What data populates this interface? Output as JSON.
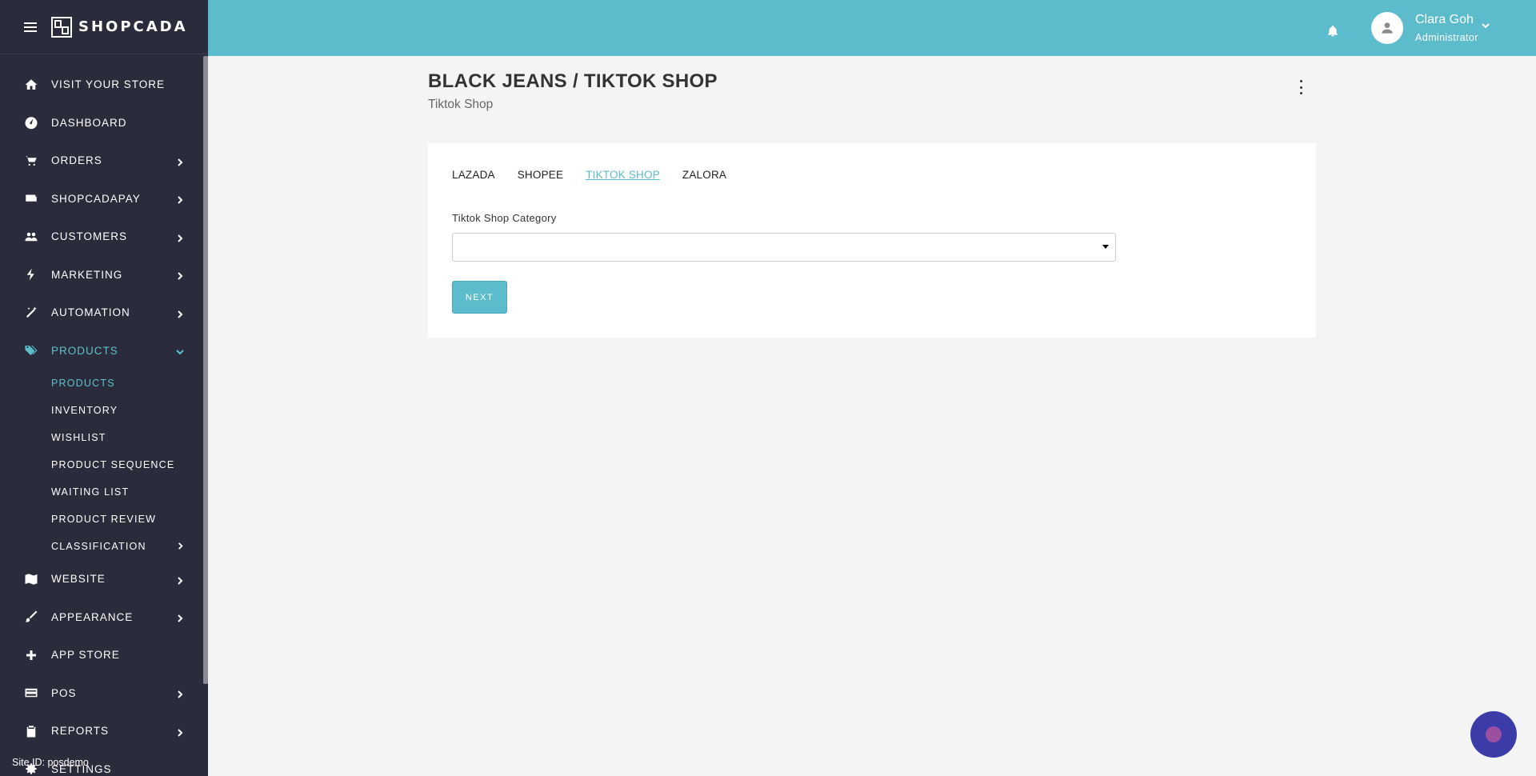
{
  "brand": {
    "name": "SHOPCADA"
  },
  "sidebar": {
    "items": [
      {
        "label": "VISIT YOUR STORE",
        "icon": "home-icon",
        "has_children": false
      },
      {
        "label": "DASHBOARD",
        "icon": "dashboard-icon",
        "has_children": false
      },
      {
        "label": "ORDERS",
        "icon": "cart-icon",
        "has_children": true
      },
      {
        "label": "SHOPCADAPAY",
        "icon": "wallet-icon",
        "has_children": true
      },
      {
        "label": "CUSTOMERS",
        "icon": "users-icon",
        "has_children": true
      },
      {
        "label": "MARKETING",
        "icon": "bolt-icon",
        "has_children": true
      },
      {
        "label": "AUTOMATION",
        "icon": "wand-icon",
        "has_children": true
      },
      {
        "label": "PRODUCTS",
        "icon": "tags-icon",
        "has_children": true,
        "expanded": true
      },
      {
        "label": "WEBSITE",
        "icon": "map-icon",
        "has_children": true
      },
      {
        "label": "APPEARANCE",
        "icon": "brush-icon",
        "has_children": true
      },
      {
        "label": "APP STORE",
        "icon": "plus-icon",
        "has_children": false
      },
      {
        "label": "POS",
        "icon": "card-icon",
        "has_children": true
      },
      {
        "label": "REPORTS",
        "icon": "clipboard-icon",
        "has_children": true
      },
      {
        "label": "SETTINGS",
        "icon": "gear-icon",
        "has_children": false
      }
    ],
    "products_sub": [
      {
        "label": "PRODUCTS",
        "active": true
      },
      {
        "label": "INVENTORY"
      },
      {
        "label": "WISHLIST"
      },
      {
        "label": "PRODUCT SEQUENCE"
      },
      {
        "label": "WAITING LIST"
      },
      {
        "label": "PRODUCT REVIEW"
      },
      {
        "label": "CLASSIFICATION",
        "has_children": true
      }
    ],
    "site_id": "Site ID: posdemo"
  },
  "topbar": {
    "user_name": "Clara Goh",
    "user_role": "Administrator"
  },
  "page": {
    "title": "BLACK JEANS / TIKTOK SHOP",
    "subtitle": "Tiktok Shop"
  },
  "tabs": [
    {
      "label": "LAZADA"
    },
    {
      "label": "SHOPEE"
    },
    {
      "label": "TIKTOK SHOP",
      "active": true
    },
    {
      "label": "ZALORA"
    }
  ],
  "form": {
    "category_label": "Tiktok Shop Category",
    "category_value": "",
    "next_label": "NEXT"
  },
  "colors": {
    "accent": "#5dbccc",
    "sidebar_bg": "#2b2c3b",
    "chat_button": "#3b3ca8"
  }
}
